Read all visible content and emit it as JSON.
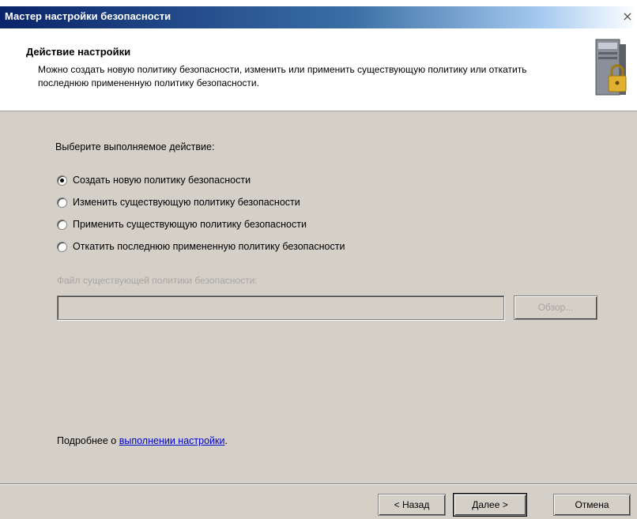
{
  "window": {
    "title": "Мастер настройки безопасности",
    "close_glyph": "×"
  },
  "header": {
    "title": "Действие настройки",
    "description": "Можно создать новую политику безопасности, изменить или применить существующую политику или откатить последнюю примененную политику безопасности.",
    "icon": "server-lock-icon"
  },
  "main": {
    "prompt": "Выберите выполняемое действие:",
    "options": [
      {
        "label": "Создать новую политику безопасности",
        "selected": true
      },
      {
        "label": "Изменить существующую политику безопасности",
        "selected": false
      },
      {
        "label": "Применить существующую политику безопасности",
        "selected": false
      },
      {
        "label": "Откатить последнюю примененную политику безопасности",
        "selected": false
      }
    ],
    "file_label": "Файл существующей политики безопасности:",
    "file_value": "",
    "browse_label": "Обзор..."
  },
  "footer": {
    "more_info_prefix": "Подробнее о ",
    "more_info_link": "выполнении настройки",
    "more_info_suffix": ".",
    "back_label": "< Назад",
    "next_label": "Далее >",
    "cancel_label": "Отмена"
  }
}
